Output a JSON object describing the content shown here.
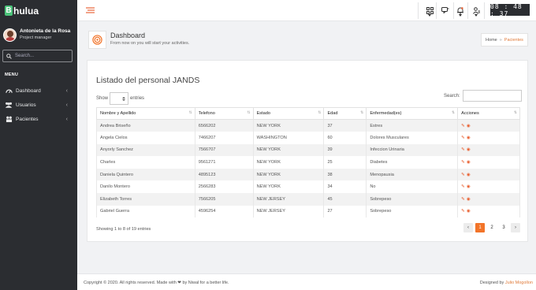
{
  "app": {
    "logo_letter": "B",
    "logo_rest": "hulua"
  },
  "user": {
    "name": "Antonieta de la Rosa",
    "role": "Project manager"
  },
  "sidebar": {
    "search_placeholder": "Search...",
    "menu_title": "MENU",
    "items": [
      {
        "label": "Dashboard",
        "icon": "gauge-icon"
      },
      {
        "label": "Usuarios",
        "icon": "users-icon"
      },
      {
        "label": "Pacientes",
        "icon": "people-icon"
      }
    ]
  },
  "topbar": {
    "clock": "08 : 48 : 37"
  },
  "header": {
    "title": "Dashboard",
    "subtitle": "From now on you will start your activities.",
    "breadcrumb": {
      "home": "Home",
      "current": "Pacientes"
    }
  },
  "card": {
    "title": "Listado del personal JANDS",
    "show_label": "Show",
    "entries_label": "entries",
    "search_label": "Search:"
  },
  "table": {
    "headers": [
      "Nombre y Apellido",
      "Telefono",
      "Estado",
      "Edad",
      "Enfermedad(es)",
      "Acciones"
    ],
    "rows": [
      [
        "Andrea Briseño",
        "6566202",
        "NEW YORK",
        "37",
        "Estres"
      ],
      [
        "Angela Cielos",
        "7466207",
        "WASHINGTON",
        "60",
        "Dolores Musculares"
      ],
      [
        "Anyorly Sanchez",
        "7566707",
        "NEW YORK",
        "39",
        "Infeccion Urinaria"
      ],
      [
        "Charles",
        "9561271",
        "NEW YORK",
        "25",
        "Diabetes"
      ],
      [
        "Daniela Quintero",
        "4895123",
        "NEW YORK",
        "38",
        "Menopausia"
      ],
      [
        "Danilo Montero",
        "2566283",
        "NEW YORK",
        "34",
        "No"
      ],
      [
        "Elizabeth Torres",
        "7566205",
        "NEW JERSEY",
        "45",
        "Sobrepeso"
      ],
      [
        "Gabriel Guerra",
        "4596254",
        "NEW JERSEY",
        "27",
        "Sobrepeso"
      ]
    ]
  },
  "pagination": {
    "info": "Showing 1 to 8 of 19 entries",
    "prev": "‹",
    "next": "›",
    "pages": [
      "1",
      "2",
      "3"
    ],
    "active_page": "1"
  },
  "footer": {
    "left": "Copyright © 2020. All rights reserved. Made with ❤ by Niwal for a better life.",
    "right_prefix": "Designed by ",
    "right_link": "Julio Mogollon"
  },
  "colors": {
    "accent": "#f27429",
    "sidebar_bg": "#2b2d31",
    "logo_green": "#4cc37a"
  }
}
